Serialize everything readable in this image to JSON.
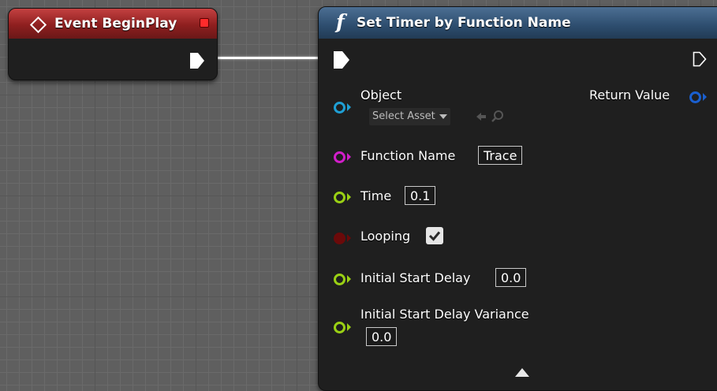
{
  "event_node": {
    "title": "Event BeginPlay",
    "icon": "diamond-icon",
    "header_color": "#9b2626",
    "delegate_pin_color": "#ff2b2b"
  },
  "function_node": {
    "title": "Set Timer by Function Name",
    "icon": "function-f-icon",
    "header_color": "#2d4d6e",
    "pins": {
      "object": {
        "label": "Object",
        "asset_picker": "Select Asset",
        "color": "#1f9fd4"
      },
      "return_value": {
        "label": "Return Value",
        "color": "#1a5fcf"
      },
      "function_name": {
        "label": "Function Name",
        "value": "Trace",
        "color": "#d11ec9"
      },
      "time": {
        "label": "Time",
        "value": "0.1",
        "color": "#9ad014"
      },
      "looping": {
        "label": "Looping",
        "checked": true,
        "color": "#6b0a0a"
      },
      "initial_start_delay": {
        "label": "Initial Start Delay",
        "value": "0.0",
        "color": "#9ad014"
      },
      "initial_start_delay_variance": {
        "label": "Initial Start Delay Variance",
        "value": "0.0",
        "color": "#9ad014"
      }
    }
  }
}
